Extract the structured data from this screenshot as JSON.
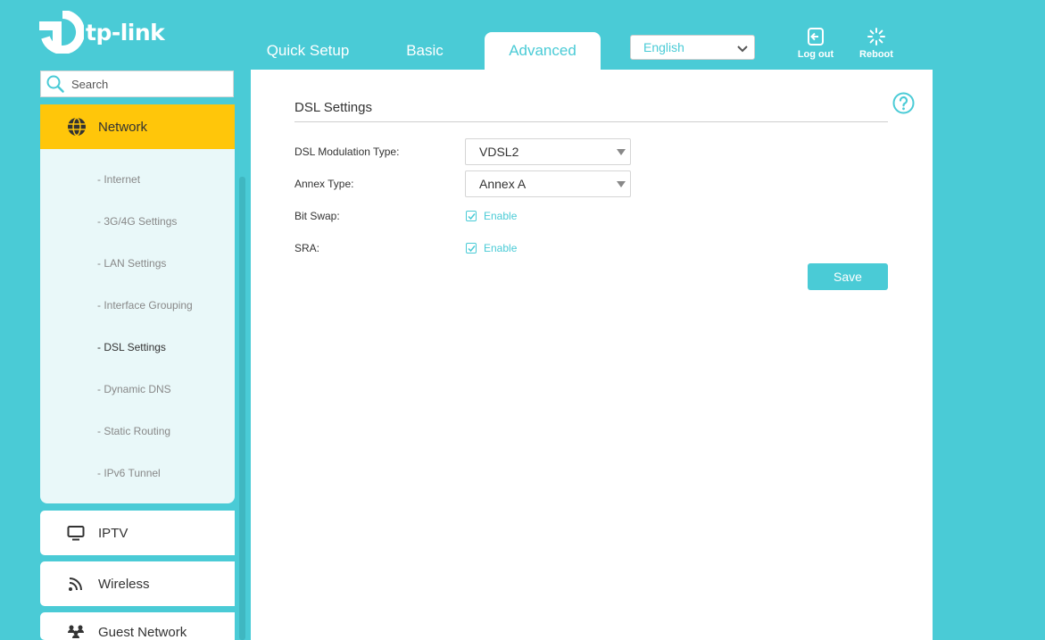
{
  "brand": {
    "name": "tp-link",
    "accent": "#4acbd6",
    "highlight": "#ffc60a"
  },
  "header": {
    "tabs": [
      {
        "label": "Quick Setup"
      },
      {
        "label": "Basic"
      },
      {
        "label": "Advanced",
        "active": true
      }
    ],
    "language": {
      "value": "English"
    },
    "logout_label": "Log out",
    "reboot_label": "Reboot"
  },
  "sidebar": {
    "search_placeholder": "Search",
    "network": {
      "label": "Network",
      "icon": "globe-icon",
      "items": [
        {
          "label": "- Internet"
        },
        {
          "label": "- 3G/4G Settings"
        },
        {
          "label": "- LAN Settings"
        },
        {
          "label": "- Interface Grouping"
        },
        {
          "label": "- DSL Settings",
          "active": true
        },
        {
          "label": "- Dynamic DNS"
        },
        {
          "label": "- Static Routing"
        },
        {
          "label": "- IPv6 Tunnel"
        }
      ]
    },
    "sections": [
      {
        "label": "IPTV",
        "icon": "monitor-icon"
      },
      {
        "label": "Wireless",
        "icon": "wifi-icon"
      },
      {
        "label": "Guest Network",
        "icon": "users-icon"
      }
    ]
  },
  "main": {
    "title": "DSL Settings",
    "fields": {
      "modulation": {
        "label": "DSL Modulation Type:",
        "value": "VDSL2"
      },
      "annex": {
        "label": "Annex Type:",
        "value": "Annex A"
      },
      "bitswap": {
        "label": "Bit Swap:",
        "checkbox_label": "Enable",
        "checked": true
      },
      "sra": {
        "label": "SRA:",
        "checkbox_label": "Enable",
        "checked": true
      }
    },
    "save_label": "Save"
  }
}
